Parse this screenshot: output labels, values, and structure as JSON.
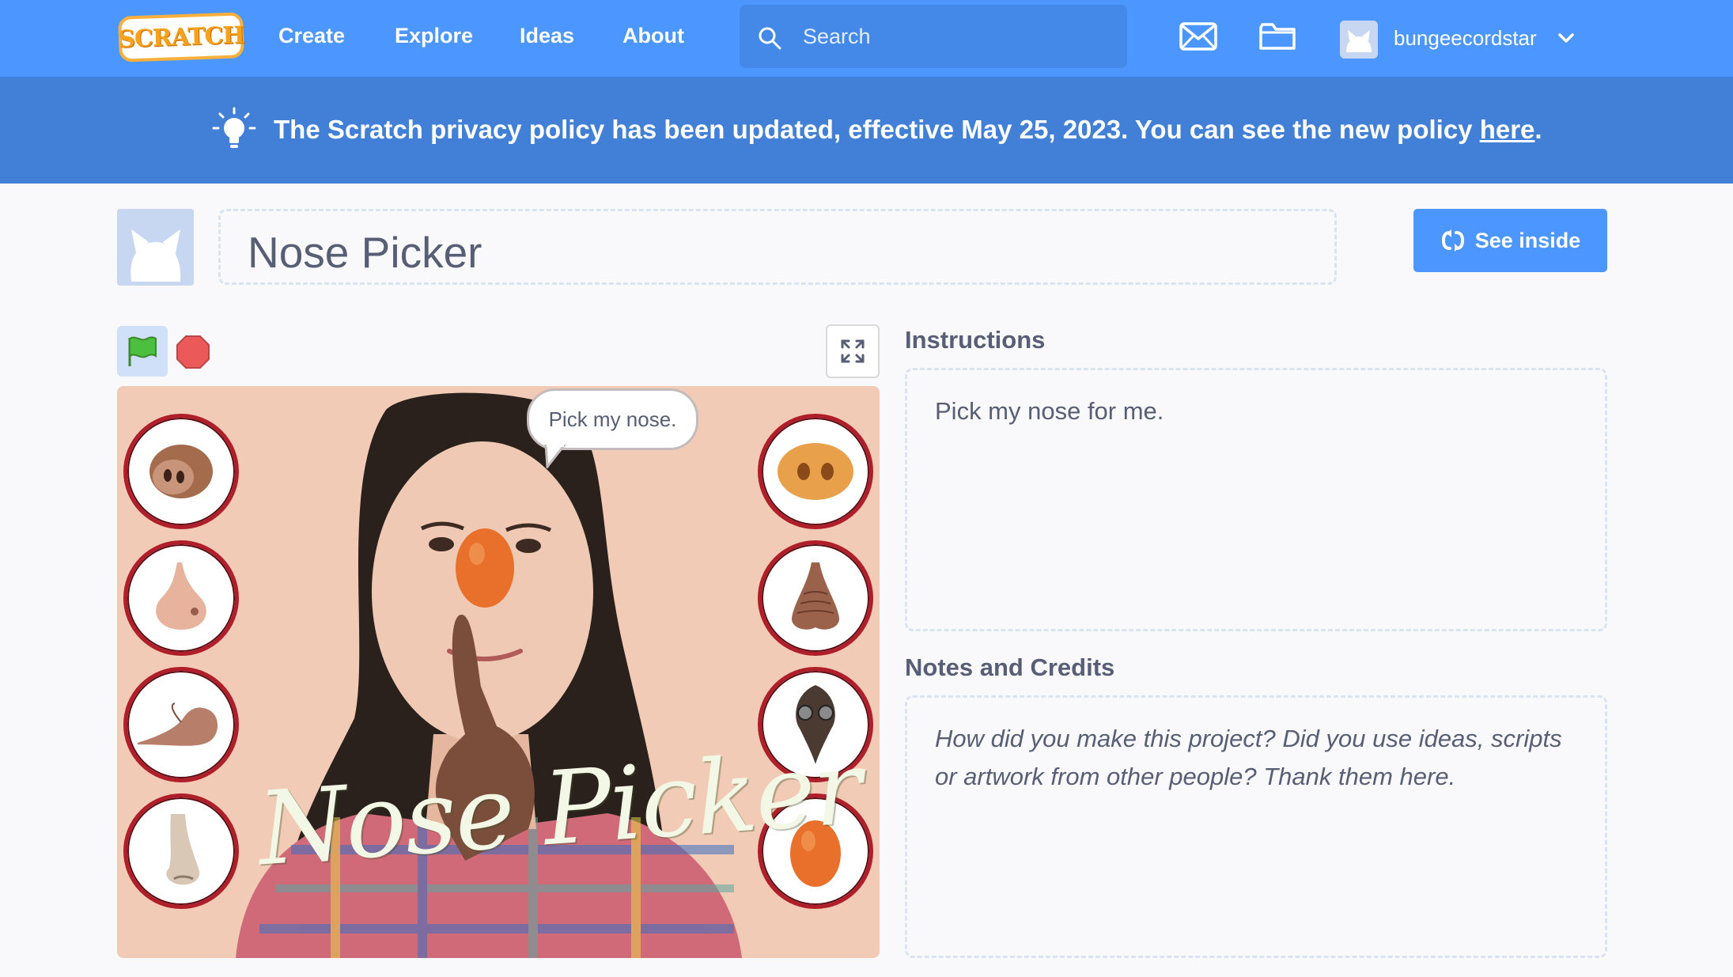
{
  "nav": {
    "logo": "SCRATCH",
    "links": [
      "Create",
      "Explore",
      "Ideas",
      "About"
    ],
    "search_placeholder": "Search",
    "username": "bungeecordstar"
  },
  "banner": {
    "text": "The Scratch privacy policy has been updated, effective May 25, 2023. You can see the new policy ",
    "link": "here",
    "end": "."
  },
  "project": {
    "title": "Nose Picker",
    "see_inside": "See inside"
  },
  "stage": {
    "speech_bubble": "Pick my nose.",
    "title_art": "Nose Picker"
  },
  "instructions": {
    "label": "Instructions",
    "text": "Pick my nose for me."
  },
  "notes": {
    "label": "Notes and Credits",
    "placeholder": "How did you make this project? Did you use ideas, scripts or artwork from other people? Thank them here."
  },
  "colors": {
    "nav": "#4c97ff",
    "banner": "#4280d7",
    "stage_bg": "#f1cbb5",
    "accent": "#4c97ff"
  }
}
